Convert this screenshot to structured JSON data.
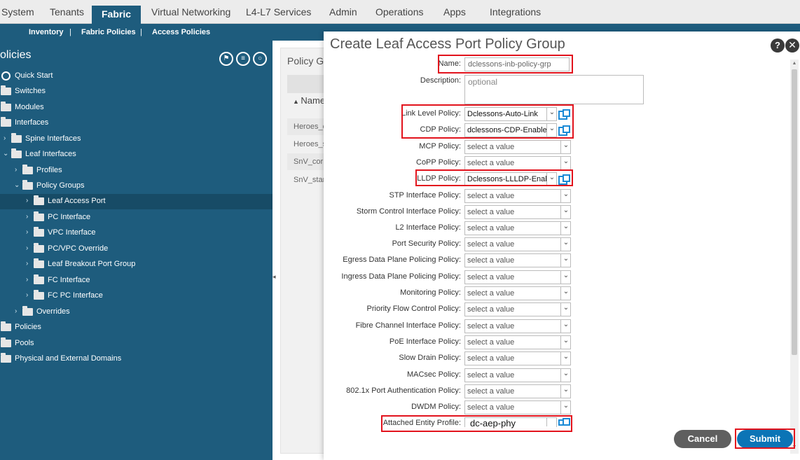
{
  "topnav": {
    "items": [
      "System",
      "Tenants",
      "Fabric",
      "Virtual Networking",
      "L4-L7 Services",
      "Admin",
      "Operations",
      "Apps",
      "Integrations"
    ],
    "active": "Fabric"
  },
  "subnav": {
    "items": [
      "Inventory",
      "Fabric Policies",
      "Access Policies"
    ],
    "separator": "|"
  },
  "tree": {
    "title": "olicies",
    "tool_icons": [
      "quick-start-icon",
      "menu-icon",
      "refresh-icon"
    ],
    "items": [
      {
        "label": "Quick Start",
        "icon": "quick-start-icon"
      },
      {
        "label": "Switches",
        "icon": "folder-icon"
      },
      {
        "label": "Modules",
        "icon": "folder-icon"
      },
      {
        "label": "Interfaces",
        "icon": "folder-icon"
      },
      {
        "label": "Spine Interfaces",
        "icon": "folder-icon"
      },
      {
        "label": "Leaf Interfaces",
        "icon": "folder-icon"
      },
      {
        "label": "Profiles",
        "icon": "folder-icon"
      },
      {
        "label": "Policy Groups",
        "icon": "folder-icon"
      },
      {
        "label": "Leaf Access Port",
        "icon": "folder-icon",
        "selected": true
      },
      {
        "label": "PC Interface",
        "icon": "folder-icon"
      },
      {
        "label": "VPC Interface",
        "icon": "folder-icon"
      },
      {
        "label": "PC/VPC Override",
        "icon": "folder-icon"
      },
      {
        "label": "Leaf Breakout Port Group",
        "icon": "folder-icon"
      },
      {
        "label": "FC Interface",
        "icon": "folder-icon"
      },
      {
        "label": "FC PC Interface",
        "icon": "folder-icon"
      },
      {
        "label": "Overrides",
        "icon": "folder-icon"
      },
      {
        "label": "Policies",
        "icon": "folder-icon"
      },
      {
        "label": "Pools",
        "icon": "folder-icon"
      },
      {
        "label": "Physical and External Domains",
        "icon": "folder-icon"
      }
    ]
  },
  "background": {
    "title": "Policy G",
    "column": "Name",
    "rows": [
      "Heroes_c",
      "Heroes_s",
      "SnV_corp",
      "SnV_star"
    ]
  },
  "dialog": {
    "title": "Create Leaf Access Port Policy Group",
    "name_label": "Name:",
    "name_value": "dclessons-inb-policy-grp",
    "description_label": "Description:",
    "description_placeholder": "optional",
    "fields": [
      {
        "label": "Link Level Policy:",
        "value": "Dclessons-Auto-Link"
      },
      {
        "label": "CDP Policy:",
        "value": "dclessons-CDP-Enable"
      },
      {
        "label": "MCP Policy:",
        "value": "select a value"
      },
      {
        "label": "CoPP Policy:",
        "value": "select a value"
      },
      {
        "label": "LLDP Policy:",
        "value": "Dclessons-LLLDP-Enal"
      },
      {
        "label": "STP Interface Policy:",
        "value": "select a value"
      },
      {
        "label": "Storm Control Interface Policy:",
        "value": "select a value"
      },
      {
        "label": "L2 Interface Policy:",
        "value": "select a value"
      },
      {
        "label": "Port Security Policy:",
        "value": "select a value"
      },
      {
        "label": "Egress Data Plane Policing Policy:",
        "value": "select a value"
      },
      {
        "label": "Ingress Data Plane Policing Policy:",
        "value": "select a value"
      },
      {
        "label": "Monitoring Policy:",
        "value": "select a value"
      },
      {
        "label": "Priority Flow Control Policy:",
        "value": "select a value"
      },
      {
        "label": "Fibre Channel Interface Policy:",
        "value": "select a value"
      },
      {
        "label": "PoE Interface Policy:",
        "value": "select a value"
      },
      {
        "label": "Slow Drain Policy:",
        "value": "select a value"
      },
      {
        "label": "MACsec Policy:",
        "value": "select a value"
      },
      {
        "label": "802.1x Port Authentication Policy:",
        "value": "select a value"
      },
      {
        "label": "DWDM Policy:",
        "value": "select a value"
      }
    ],
    "aep_label": "Attached Entity Profile:",
    "aep_value": "dc-aep-phy",
    "cancel_label": "Cancel",
    "submit_label": "Submit",
    "help_label": "?",
    "close_label": "✕"
  },
  "colors": {
    "nav_bg": "#1e5c7d",
    "highlight": "#e2131d",
    "submit": "#0b74b6",
    "cancel": "#5f5f5f",
    "link_icon": "#1b8ad6"
  }
}
